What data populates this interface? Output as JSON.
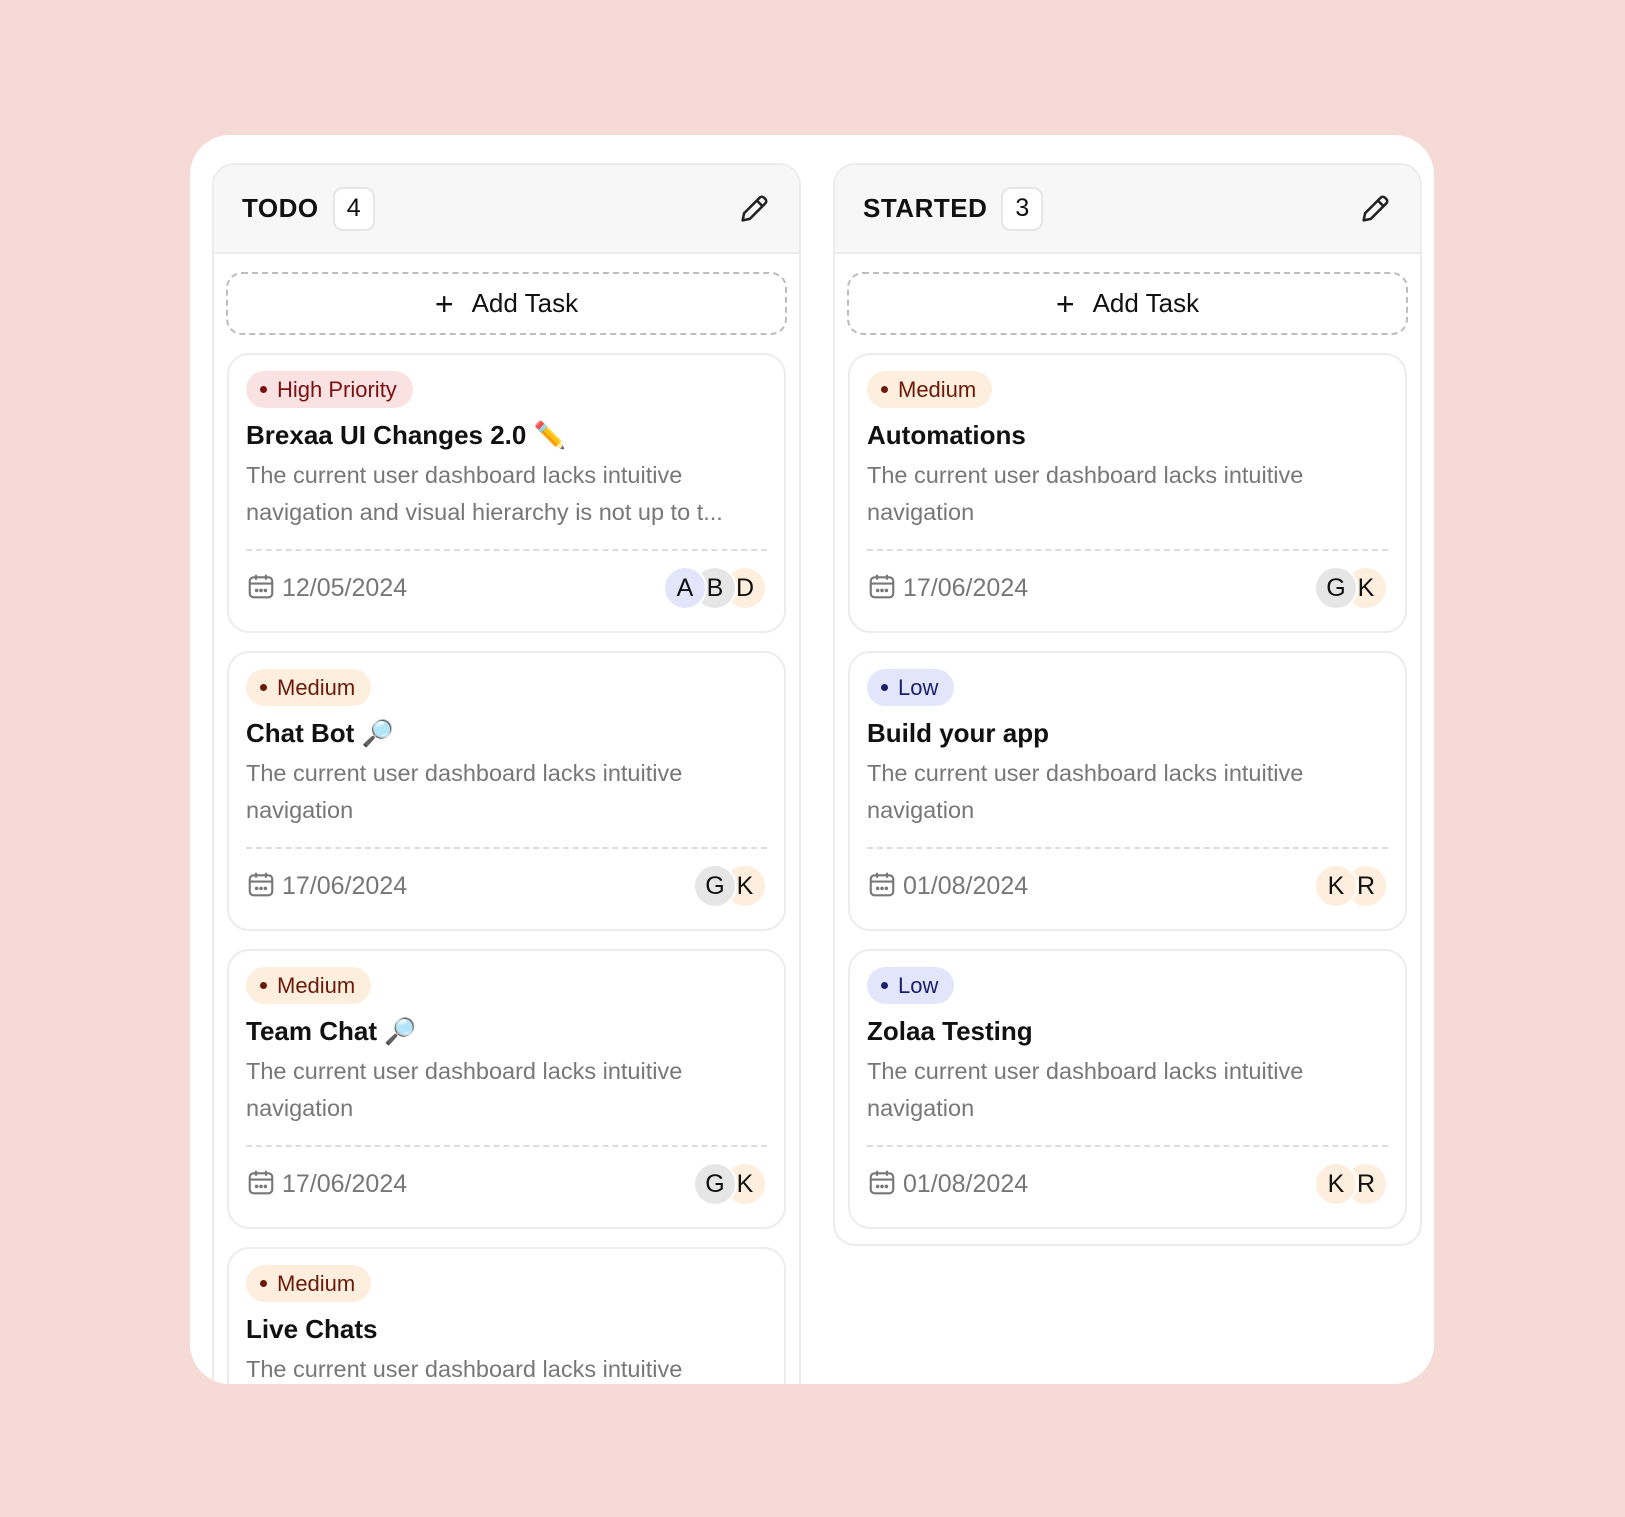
{
  "columns": [
    {
      "title": "TODO",
      "count": "4",
      "add_label": "Add Task",
      "cards": [
        {
          "priority": "High Priority",
          "level": "high",
          "title": "Brexaa UI Changes 2.0 ✏️",
          "desc": "The current user dashboard lacks intuitive navigation and visual hierarchy is not up to t...",
          "date": "12/05/2024",
          "avatars": [
            "A",
            "B",
            "D"
          ]
        },
        {
          "priority": "Medium",
          "level": "medium",
          "title": "Chat Bot 🔎",
          "desc": "The current user dashboard lacks intuitive navigation",
          "date": "17/06/2024",
          "avatars": [
            "G",
            "K"
          ]
        },
        {
          "priority": "Medium",
          "level": "medium",
          "title": "Team Chat 🔎",
          "desc": "The current user dashboard lacks intuitive navigation",
          "date": "17/06/2024",
          "avatars": [
            "G",
            "K"
          ]
        },
        {
          "priority": "Medium",
          "level": "medium",
          "title": "Live Chats",
          "desc": "The current user dashboard lacks intuitive navigation",
          "date": "",
          "avatars": []
        }
      ]
    },
    {
      "title": "STARTED",
      "count": "3",
      "add_label": "Add Task",
      "cards": [
        {
          "priority": "Medium",
          "level": "medium",
          "title": "Automations",
          "desc": "The current user dashboard lacks intuitive navigation",
          "date": "17/06/2024",
          "avatars": [
            "G",
            "K"
          ]
        },
        {
          "priority": "Low",
          "level": "low",
          "title": "Build your app",
          "desc": "The current user dashboard lacks intuitive navigation",
          "date": "01/08/2024",
          "avatars": [
            "K",
            "R"
          ]
        },
        {
          "priority": "Low",
          "level": "low",
          "title": "Zolaa Testing",
          "desc": "The current user dashboard lacks intuitive navigation",
          "date": "01/08/2024",
          "avatars": [
            "K",
            "R"
          ]
        }
      ]
    }
  ],
  "colors": {
    "page_bg": "#f5dad5",
    "high": {
      "bg": "#fbe2e2",
      "fg": "#7a1010"
    },
    "medium": {
      "bg": "#fdeedd",
      "fg": "#6b1a0a"
    },
    "low": {
      "bg": "#e3e6fb",
      "fg": "#1a1f6b"
    },
    "avatar": {
      "A": "#e3e6fb",
      "B": "#e6e6e6",
      "D": "#fdeedd",
      "G": "#e6e6e6",
      "K": "#fdeedd",
      "R": "#fdeedd"
    }
  }
}
